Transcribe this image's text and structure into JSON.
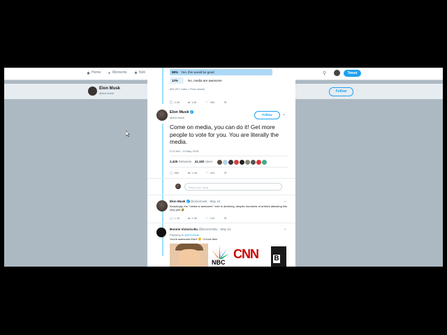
{
  "nav": {
    "home": "Home",
    "moments": "Moments",
    "notifications": "Noti",
    "tweet_button": "Tweet"
  },
  "background_profile": {
    "name": "Elon Musk",
    "handle": "@elonmusk",
    "follow": "Follow"
  },
  "poll": {
    "option1_pct": "88%",
    "option1_label": "Yes, this would be good",
    "option1_fraction": 0.88,
    "option2_pct": "12%",
    "option2_label": "No, media are awesome",
    "votes_text": "681,097 votes • Final results"
  },
  "poll_actions": {
    "replies": "4.9K",
    "retweets": "14K",
    "likes": "39K"
  },
  "main_tweet": {
    "name": "Elon Musk",
    "handle": "@elonmusk",
    "follow": "Follow",
    "text": "Come on media, you can do it! Get more people to vote for you. You are literally the media.",
    "timestamp": "3:22 AM - 24 May 2018",
    "retweets_count": "2,425",
    "retweets_label": "Retweets",
    "likes_count": "41,182",
    "likes_label": "Likes",
    "replies": "869",
    "rts": "2.4K",
    "favs": "41K",
    "reply_placeholder": "Tweet your reply"
  },
  "reply1": {
    "name": "Elon Musk",
    "handle": "@elonmusk · May 24",
    "text": "Amazingly, the \"media is awesome\" vote is declining, despite hundreds of articles attacking this very poll 🤣",
    "replies": "1.1K",
    "rts": "2.5K",
    "favs": "21K"
  },
  "reply2": {
    "name": "Bonnie Victoria Bu",
    "handle": "@BonnieVBu · May 24",
    "replying_prefix": "Replying to",
    "replying_to": "@elonmusk",
    "text": "You're awesome Elon!   ✊ <3 love this!",
    "logo_nbc": "NBC",
    "logo_cnn": "CNN",
    "logo_bbc": "B"
  },
  "colors": {
    "accent": "#1da1f2",
    "poll_fill": "#add8f6",
    "poll_fill_light": "#e1f0fa",
    "background": "#000000",
    "overlay": "#adb9c2"
  }
}
